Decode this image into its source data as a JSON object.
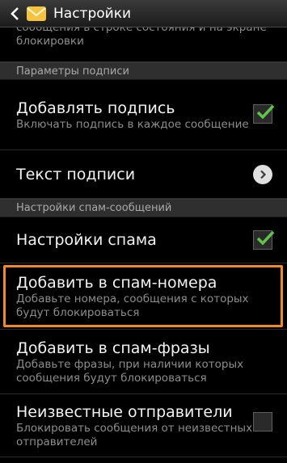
{
  "header": {
    "title": "Настройки",
    "back_icon": "back-chevron-icon",
    "app_icon": "messages-envelope-icon"
  },
  "partial_item": {
    "summary": "сообщения в строке состояния и на экране блокировки"
  },
  "sections": [
    {
      "title": "Параметры подписи",
      "items": [
        {
          "title": "Добавлять подпись",
          "summary": "Включать подпись в каждое сообщение",
          "control": "checkbox",
          "checked": true
        },
        {
          "title": "Текст подписи",
          "summary": "",
          "control": "arrow"
        }
      ]
    },
    {
      "title": "Настройки спам-сообщений",
      "items": [
        {
          "title": "Настройки спама",
          "summary": "",
          "control": "checkbox",
          "checked": true
        },
        {
          "title": "Добавить в спам-номера",
          "summary": "Добавьте номера, сообщения с которых будут блокироваться",
          "control": "none",
          "highlighted": true
        },
        {
          "title": "Добавить в спам-фразы",
          "summary": "Добавьте фразы, при наличии которых сообщения будут блокироваться",
          "control": "none"
        },
        {
          "title": "Неизвестные отправители",
          "summary": "Блокировать сообщения от неизвестных отправителей",
          "control": "checkbox",
          "checked": false
        }
      ]
    }
  ],
  "colors": {
    "accent_check": "#5fc44a",
    "highlight": "#f08a24",
    "section_bg": "#2f2f2f"
  }
}
